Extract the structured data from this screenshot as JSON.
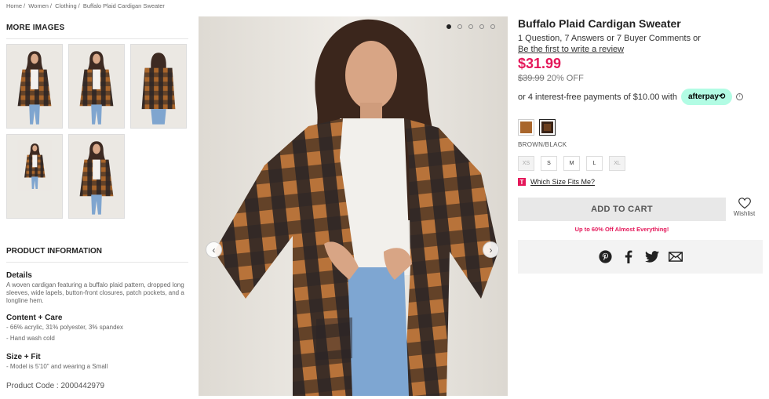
{
  "breadcrumb": [
    "Home",
    "Women",
    "Clothing",
    "Buffalo Plaid Cardigan Sweater"
  ],
  "breadcrumb_sep": "/",
  "more_images": {
    "title": "MORE IMAGES",
    "count": 5
  },
  "product_info": {
    "header": "PRODUCT INFORMATION",
    "details_title": "Details",
    "details_text": "A woven cardigan featuring a buffalo plaid pattern, dropped long sleeves, wide lapels, button-front closures, patch pockets, and a longline hem.",
    "content_title": "Content + Care",
    "content_items": [
      "- 66% acrylic, 31% polyester, 3% spandex",
      "- Hand wash cold"
    ],
    "size_title": "Size + Fit",
    "size_items": [
      "- Model is 5'10\" and wearing a Small"
    ],
    "product_code": "Product Code : 2000442979"
  },
  "gallery": {
    "dots": 5,
    "active_dot": 0,
    "prev_icon": "‹",
    "next_icon": "›"
  },
  "product": {
    "title": "Buffalo Plaid Cardigan Sweater",
    "qa_text": "1 Question, 7 Answers or 7 Buyer Comments or",
    "review_link": "Be the first to write a review",
    "price": "$31.99",
    "original_price": "$39.99",
    "discount": "20% OFF",
    "afterpay_text": "or 4 interest-free payments of $10.00 with",
    "afterpay_badge": "afterpay⟲",
    "info_icon": "i",
    "color_name": "BROWN/BLACK",
    "sizes": [
      {
        "label": "XS",
        "available": false
      },
      {
        "label": "S",
        "available": true
      },
      {
        "label": "M",
        "available": true
      },
      {
        "label": "L",
        "available": true
      },
      {
        "label": "XL",
        "available": false
      }
    ],
    "fit_badge": "T",
    "fit_link": "Which Size Fits Me?",
    "add_to_cart": "ADD TO CART",
    "wishlist": "Wishlist",
    "promo": "Up to 60% Off Almost Everything!"
  },
  "colors": {
    "accent": "#e4185a",
    "afterpay": "#b2fce4",
    "plaid_brown": "#a0622a",
    "plaid_black": "#1e1e22"
  }
}
